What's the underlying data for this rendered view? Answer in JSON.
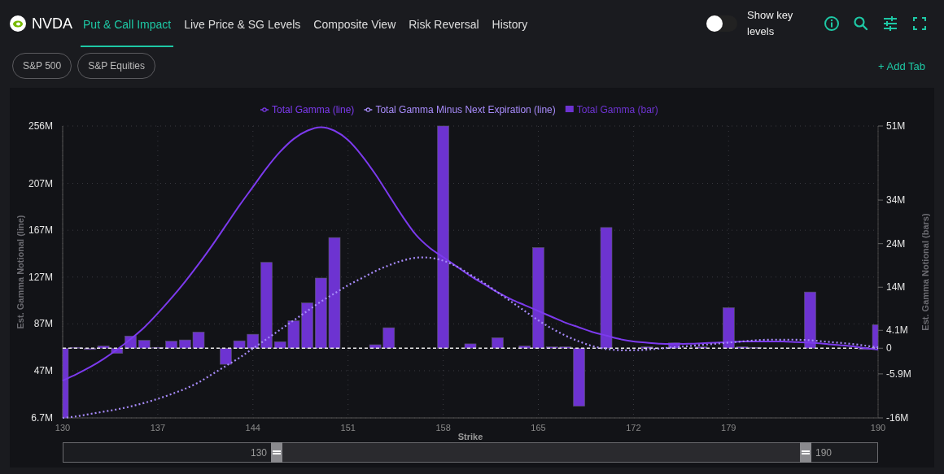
{
  "header": {
    "ticker": "NVDA",
    "tabs": [
      {
        "label": "Put & Call Impact",
        "selected": true
      },
      {
        "label": "Live Price & SG Levels",
        "selected": false
      },
      {
        "label": "Composite View",
        "selected": false
      },
      {
        "label": "Risk Reversal",
        "selected": false
      },
      {
        "label": "History",
        "selected": false
      }
    ],
    "toggle": {
      "label": "Show key levels",
      "on": false
    }
  },
  "chips": [
    "S&P 500",
    "S&P Equities"
  ],
  "add_tab": "+ Add Tab",
  "chart": {
    "chart_data": {
      "type": "bar",
      "xlabel": "Strike",
      "ylabel": "Est. Gamma Notional (line)",
      "y2label": "Est. Gamma Notional (bars)",
      "grid": true,
      "legend": "top",
      "ref_lines": [
        {
          "axis": "y2",
          "value": 0
        }
      ],
      "xlim": [
        130,
        190
      ],
      "ylim": [
        6.7,
        256
      ],
      "y2lim": [
        -16,
        51
      ],
      "xticks": [
        130,
        137,
        144,
        151,
        158,
        165,
        172,
        179,
        190
      ],
      "yticks": [
        {
          "value": 256,
          "label": "256M"
        },
        {
          "value": 207,
          "label": "207M"
        },
        {
          "value": 167,
          "label": "167M"
        },
        {
          "value": 127,
          "label": "127M"
        },
        {
          "value": 87,
          "label": "87M"
        },
        {
          "value": 47,
          "label": "47M"
        },
        {
          "value": 6.7,
          "label": "6.7M"
        }
      ],
      "y2ticks": [
        {
          "value": 51,
          "label": "51M"
        },
        {
          "value": 34,
          "label": "34M"
        },
        {
          "value": 24,
          "label": "24M"
        },
        {
          "value": 14,
          "label": "14M"
        },
        {
          "value": 4.1,
          "label": "4.1M"
        },
        {
          "value": 0,
          "label": "0"
        },
        {
          "value": -5.9,
          "label": "-5.9M"
        },
        {
          "value": -16,
          "label": "-16M"
        }
      ],
      "x": [
        130,
        131,
        132,
        133,
        134,
        135,
        136,
        137,
        138,
        139,
        140,
        141,
        142,
        143,
        144,
        145,
        146,
        147,
        148,
        149,
        150,
        151,
        152,
        153,
        154,
        155,
        156,
        157,
        158,
        159,
        160,
        161,
        162,
        163,
        164,
        165,
        166,
        167,
        168,
        169,
        170,
        171,
        172,
        173,
        174,
        175,
        176,
        177,
        178,
        179,
        180,
        181,
        182,
        183,
        184,
        185,
        186,
        187,
        188,
        189,
        190
      ],
      "series": [
        {
          "name": "Total Gamma (line)",
          "type": "line",
          "color": "#7c3aed",
          "values": [
            38.6,
            44,
            50,
            57,
            65,
            74,
            84,
            96,
            109,
            123,
            138,
            154,
            171,
            188,
            204,
            220,
            234,
            245,
            252,
            255,
            252,
            244,
            231,
            215,
            197,
            179,
            163,
            152,
            144,
            136,
            128,
            121,
            114,
            108,
            103,
            98,
            93,
            88,
            84,
            80,
            77,
            74,
            72,
            71,
            70,
            70,
            70,
            70.5,
            71,
            71.5,
            72,
            72,
            72,
            72,
            71.5,
            71,
            70,
            69,
            68,
            66.5,
            65
          ]
        },
        {
          "name": "Total Gamma Minus Next Expiration (line)",
          "type": "line",
          "line_style": "dotted",
          "color": "#a78bfa",
          "values": [
            6.7,
            8,
            10,
            12,
            14,
            16.5,
            19.5,
            23,
            27,
            31.5,
            37,
            44,
            51,
            58,
            66,
            74,
            82,
            90,
            98,
            106,
            113,
            120,
            126,
            132,
            137,
            141,
            143.5,
            143.5,
            141,
            136,
            129,
            122,
            114,
            106,
            98,
            90,
            83,
            77,
            72,
            68,
            65.5,
            64.5,
            64.5,
            65,
            66,
            67,
            68,
            69,
            70,
            71,
            72,
            73,
            73.5,
            73.5,
            73.5,
            73,
            72,
            71,
            70,
            68.5,
            67
          ]
        },
        {
          "name": "Total Gamma (bar)",
          "axis": "y2",
          "color": "#6d33d1",
          "values": [
            -16,
            0.2,
            -0.3,
            0.5,
            -1.2,
            2.8,
            1.8,
            0.2,
            1.6,
            1.9,
            3.7,
            0,
            -3.7,
            1.7,
            3.2,
            19.7,
            1.5,
            6.3,
            10.4,
            16.1,
            25.4,
            0,
            0,
            0.8,
            4.7,
            0,
            0,
            0,
            51,
            0,
            1.0,
            0,
            2.4,
            0,
            0.5,
            23.1,
            0.3,
            0.3,
            -13.3,
            0,
            27.7,
            0,
            0,
            0.3,
            0,
            1.2,
            0,
            0.3,
            0,
            9.3,
            0.3,
            0.2,
            0,
            0,
            0,
            12.9,
            0,
            0,
            0,
            -0.3,
            5.4
          ]
        }
      ]
    }
  },
  "range_slider": {
    "handles": [
      {
        "label": "130",
        "level": 0.262
      },
      {
        "label": "190",
        "level": 0.912
      }
    ]
  }
}
